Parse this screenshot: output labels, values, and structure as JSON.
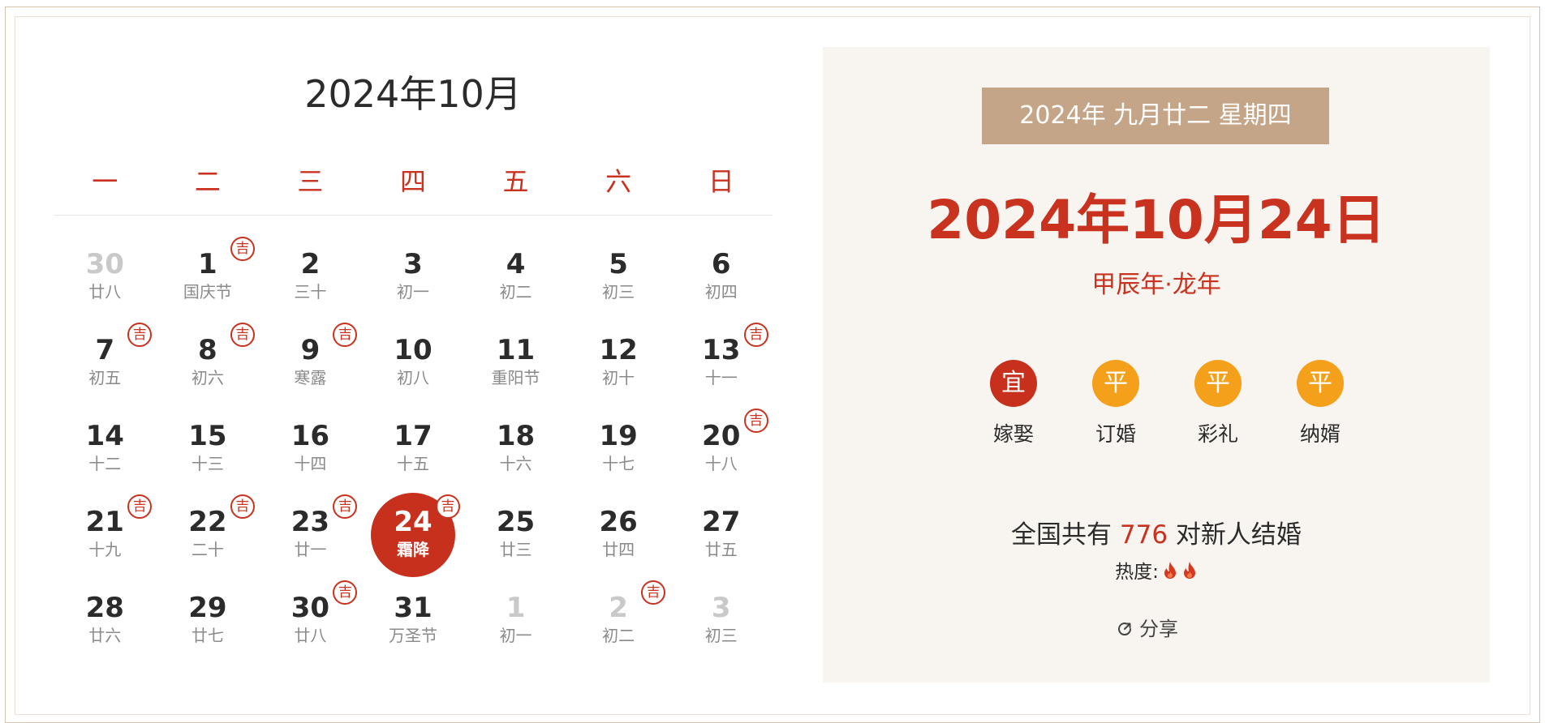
{
  "calendar": {
    "title": "2024年10月",
    "weekdays": [
      "一",
      "二",
      "三",
      "四",
      "五",
      "六",
      "日"
    ],
    "ji_label": "吉",
    "days": [
      {
        "num": "30",
        "lunar": "廿八",
        "muted": true,
        "ji": false
      },
      {
        "num": "1",
        "lunar": "国庆节",
        "muted": false,
        "ji": true
      },
      {
        "num": "2",
        "lunar": "三十",
        "muted": false,
        "ji": false
      },
      {
        "num": "3",
        "lunar": "初一",
        "muted": false,
        "ji": false
      },
      {
        "num": "4",
        "lunar": "初二",
        "muted": false,
        "ji": false
      },
      {
        "num": "5",
        "lunar": "初三",
        "muted": false,
        "ji": false
      },
      {
        "num": "6",
        "lunar": "初四",
        "muted": false,
        "ji": false
      },
      {
        "num": "7",
        "lunar": "初五",
        "muted": false,
        "ji": true
      },
      {
        "num": "8",
        "lunar": "初六",
        "muted": false,
        "ji": true
      },
      {
        "num": "9",
        "lunar": "寒露",
        "muted": false,
        "ji": true
      },
      {
        "num": "10",
        "lunar": "初八",
        "muted": false,
        "ji": false
      },
      {
        "num": "11",
        "lunar": "重阳节",
        "muted": false,
        "ji": false
      },
      {
        "num": "12",
        "lunar": "初十",
        "muted": false,
        "ji": false
      },
      {
        "num": "13",
        "lunar": "十一",
        "muted": false,
        "ji": true
      },
      {
        "num": "14",
        "lunar": "十二",
        "muted": false,
        "ji": false
      },
      {
        "num": "15",
        "lunar": "十三",
        "muted": false,
        "ji": false
      },
      {
        "num": "16",
        "lunar": "十四",
        "muted": false,
        "ji": false
      },
      {
        "num": "17",
        "lunar": "十五",
        "muted": false,
        "ji": false
      },
      {
        "num": "18",
        "lunar": "十六",
        "muted": false,
        "ji": false
      },
      {
        "num": "19",
        "lunar": "十七",
        "muted": false,
        "ji": false
      },
      {
        "num": "20",
        "lunar": "十八",
        "muted": false,
        "ji": true
      },
      {
        "num": "21",
        "lunar": "十九",
        "muted": false,
        "ji": true
      },
      {
        "num": "22",
        "lunar": "二十",
        "muted": false,
        "ji": true
      },
      {
        "num": "23",
        "lunar": "廿一",
        "muted": false,
        "ji": true
      },
      {
        "num": "24",
        "lunar": "霜降",
        "muted": false,
        "ji": true,
        "today": true
      },
      {
        "num": "25",
        "lunar": "廿三",
        "muted": false,
        "ji": false
      },
      {
        "num": "26",
        "lunar": "廿四",
        "muted": false,
        "ji": false
      },
      {
        "num": "27",
        "lunar": "廿五",
        "muted": false,
        "ji": false
      },
      {
        "num": "28",
        "lunar": "廿六",
        "muted": false,
        "ji": false
      },
      {
        "num": "29",
        "lunar": "廿七",
        "muted": false,
        "ji": false
      },
      {
        "num": "30",
        "lunar": "廿八",
        "muted": false,
        "ji": true
      },
      {
        "num": "31",
        "lunar": "万圣节",
        "muted": false,
        "ji": false
      },
      {
        "num": "1",
        "lunar": "初一",
        "muted": true,
        "ji": false
      },
      {
        "num": "2",
        "lunar": "初二",
        "muted": true,
        "ji": true
      },
      {
        "num": "3",
        "lunar": "初三",
        "muted": true,
        "ji": false
      }
    ]
  },
  "detail": {
    "lunar_bar": "2024年 九月廿二 星期四",
    "big_date": "2024年10月24日",
    "ganzhi": "甲辰年·龙年",
    "activities": [
      {
        "badge": "宜",
        "label": "嫁娶",
        "color": "#c6301c"
      },
      {
        "badge": "平",
        "label": "订婚",
        "color": "#f5a01a"
      },
      {
        "badge": "平",
        "label": "彩礼",
        "color": "#f5a01a"
      },
      {
        "badge": "平",
        "label": "纳婿",
        "color": "#f5a01a"
      }
    ],
    "count_prefix": "全国共有 ",
    "count_number": "776",
    "count_suffix": " 对新人结婚",
    "heat_label": "热度:",
    "heat_flames": 2,
    "share_label": "分享"
  },
  "colors": {
    "accent_red": "#c8321f",
    "tan": "#c4a587",
    "panel_bg": "#f8f4f0",
    "orange": "#f5a01a"
  }
}
